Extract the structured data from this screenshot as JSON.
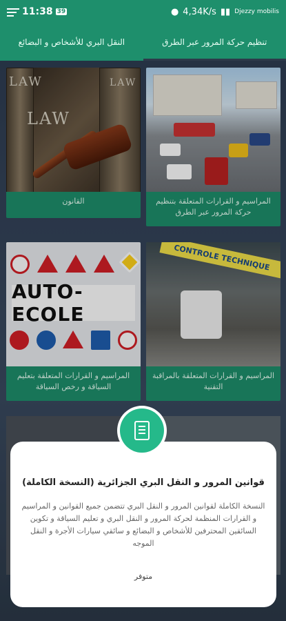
{
  "statusbar": {
    "time": "11:38",
    "badge": "39",
    "speed": "4,34K/s",
    "carrier": "Djezzy mobilis"
  },
  "tabs": [
    {
      "label": "النقل البري للأشخاص و البضائع"
    },
    {
      "label": "تنظيم حركة المرور عبر الطرق"
    }
  ],
  "cards": [
    {
      "caption": "القانون"
    },
    {
      "caption": "المراسيم و القرارات المتعلقة بتنظيم حركة المرور عبر الطرق"
    },
    {
      "caption": "المراسيم و القرارات المتعلقة بتعليم السياقة و رخص السياقة"
    },
    {
      "caption": "المراسيم و القرارات المتعلقة بالمراقبة التقنية"
    }
  ],
  "images": {
    "law_word": "LAW",
    "auto_ecole": "AUTO-ECOLE",
    "garage_banner": "CONTROLE TECHNIQUE"
  },
  "dialog": {
    "title": "قوانين المرور و النقل البري الجزائرية (النسخة الكاملة)",
    "body": "النسخة الكاملة لقوانين المرور و النقل البري تتضمن جميع القوانين و المراسيم و القرارات المنظمة لحركة المرور و النقل البري و تعليم السياقة و تكوين السائقين المحترفين للأشخاص و البضائع و سائقي سيارات الأجرة و النقل الموجه",
    "available": "متوفر"
  },
  "colors": {
    "primary": "#1e8f6c",
    "accent": "#25b98a",
    "background": "#2d3a4a"
  }
}
